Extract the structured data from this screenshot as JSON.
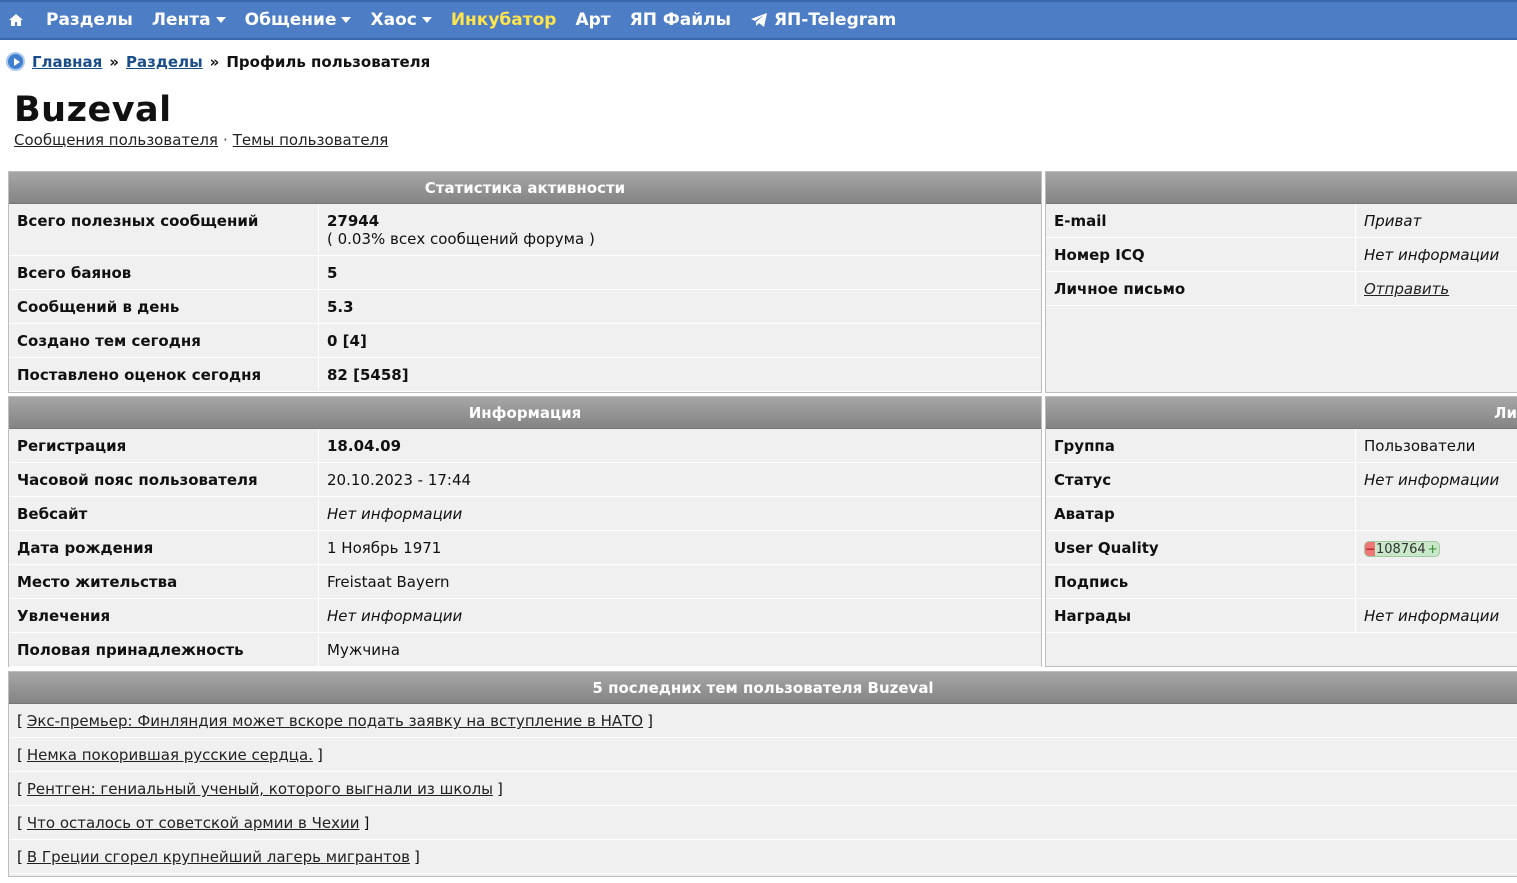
{
  "nav": {
    "items": [
      {
        "label": "Разделы",
        "caret": false,
        "highlight": false
      },
      {
        "label": "Лента",
        "caret": true,
        "highlight": false
      },
      {
        "label": "Общение",
        "caret": true,
        "highlight": false
      },
      {
        "label": "Хаос",
        "caret": true,
        "highlight": false
      },
      {
        "label": "Инкубатор",
        "caret": false,
        "highlight": true
      },
      {
        "label": "Арт",
        "caret": false,
        "highlight": false
      },
      {
        "label": "ЯП Файлы",
        "caret": false,
        "highlight": false
      },
      {
        "label": "ЯП-Telegram",
        "caret": false,
        "highlight": false
      }
    ],
    "home_icon": "home-icon",
    "telegram_icon": "telegram-icon",
    "highlight_color": "#ffe44c",
    "bar_color": "#4d7dc4"
  },
  "breadcrumb": {
    "home": "Главная",
    "sections": "Разделы",
    "sep": "»",
    "current": "Профиль пользователя"
  },
  "profile": {
    "username": "Buzeval",
    "links": {
      "posts": "Сообщения пользователя",
      "sep": "·",
      "topics": "Темы пользователя"
    }
  },
  "activity": {
    "title": "Статистика активности",
    "rows": [
      {
        "label": "Всего полезных сообщений",
        "value": "27944",
        "sub": "( 0.03% всех сообщений форума )"
      },
      {
        "label": "Всего баянов",
        "value": "5"
      },
      {
        "label": "Сообщений в день",
        "value": "5.3"
      },
      {
        "label": "Создано тем сегодня",
        "value": "0 [4]"
      },
      {
        "label": "Поставлено оценок сегодня",
        "value": "82 [5458]"
      }
    ]
  },
  "contacts": {
    "title": "",
    "rows": [
      {
        "label": "E-mail",
        "value": "Приват"
      },
      {
        "label": "Номер ICQ",
        "value": "Нет информации"
      },
      {
        "label": "Личное письмо",
        "value": "Отправить"
      }
    ]
  },
  "info": {
    "title": "Информация",
    "rows": [
      {
        "label": "Регистрация",
        "value": "18.04.09"
      },
      {
        "label": "Часовой пояс пользователя",
        "value": "20.10.2023 - 17:44"
      },
      {
        "label": "Вебсайт",
        "value": "Нет информации"
      },
      {
        "label": "Дата рождения",
        "value": "1 Ноябрь 1971"
      },
      {
        "label": "Место жительства",
        "value": "Freistaat Bayern"
      },
      {
        "label": "Увлечения",
        "value": "Нет информации"
      },
      {
        "label": "Половая принадлежность",
        "value": "Мужчина"
      }
    ]
  },
  "personal": {
    "title": "Ли",
    "rows": [
      {
        "label": "Группа",
        "value": "Пользователи"
      },
      {
        "label": "Статус",
        "value": "Нет информации"
      },
      {
        "label": "Аватар",
        "value": ""
      },
      {
        "label": "User Quality",
        "value": "108764",
        "minus": "−",
        "plus": "+"
      },
      {
        "label": "Подпись",
        "value": ""
      },
      {
        "label": "Награды",
        "value": "Нет информации"
      }
    ]
  },
  "recent": {
    "title": "5 последних тем пользователя Buzeval",
    "open": "[",
    "close": "]",
    "topics": [
      "Экс-премьер: Финляндия может вскоре подать заявку на вступление в НАТО",
      "Немка покорившая русские сердца.",
      "Рентген: гениальный ученый, которого выгнали из школы",
      "Что осталось от советской армии в Чехии",
      "В Греции сгорел крупнейший лагерь мигрантов"
    ]
  }
}
